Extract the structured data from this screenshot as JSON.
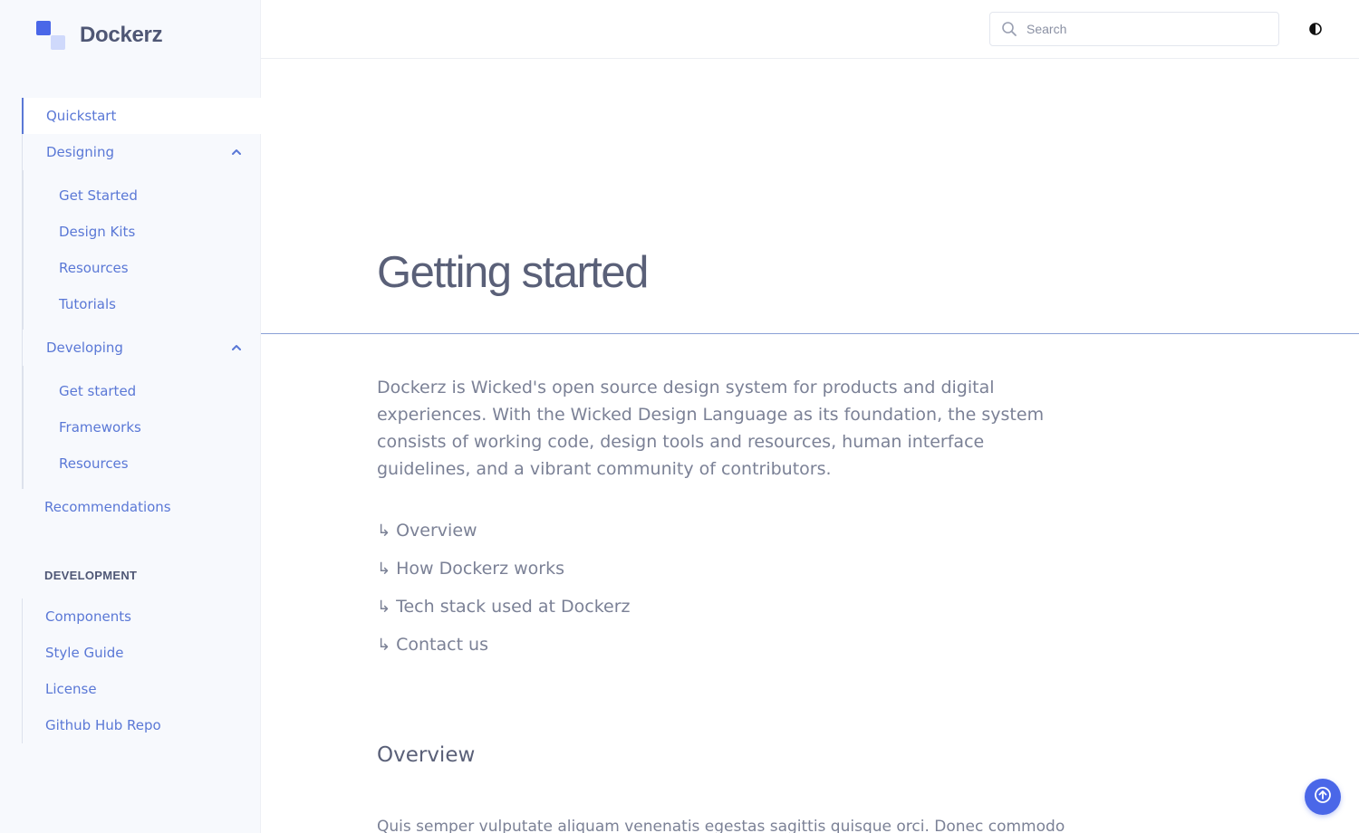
{
  "brand": {
    "name": "Dockerz"
  },
  "search": {
    "placeholder": "Search"
  },
  "colors": {
    "accent": "#4a67e8",
    "link": "#5a78d6",
    "text": "#5a6078",
    "muted": "#7b8196"
  },
  "sidebar": {
    "quickstart": "Quickstart",
    "designing": {
      "label": "Designing",
      "items": [
        "Get Started",
        "Design Kits",
        "Resources",
        "Tutorials"
      ]
    },
    "developing": {
      "label": "Developing",
      "items": [
        "Get started",
        "Frameworks",
        "Resources"
      ]
    },
    "recommendations": "Recommendations",
    "section_title": "DEVELOPMENT",
    "development_items": [
      "Components",
      "Style Guide",
      "License",
      "Github Hub Repo"
    ]
  },
  "main": {
    "title": "Getting started",
    "intro": "Dockerz is Wicked's open source design system for products and digital experiences. With the Wicked Design Language as its foundation, the system consists of working code, design tools and resources, human interface guidelines, and a vibrant community of contributors.",
    "toc_arrow": "↳",
    "toc": [
      "Overview",
      "How Dockerz works",
      "Tech stack used at Dockerz",
      "Contact us"
    ],
    "overview_title": "Overview",
    "overview_text": "Quis semper vulputate aliquam venenatis egestas sagittis quisque orci. Donec commodo sit"
  },
  "icons": {
    "search": "search-icon",
    "theme": "contrast-icon",
    "chevron": "chevron-up-icon",
    "scroll_top": "arrow-up-circle-icon"
  }
}
